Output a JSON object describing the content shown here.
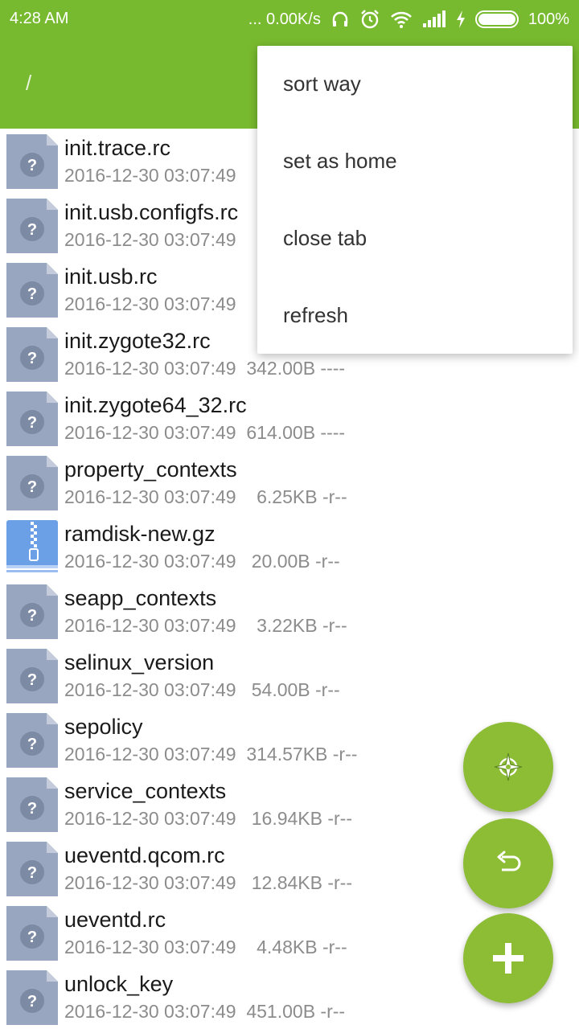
{
  "status_bar": {
    "time": "4:28 AM",
    "network_speed": "... 0.00K/s",
    "battery_percent": "100%",
    "icons": [
      "headset-icon",
      "alarm-icon",
      "wifi-icon",
      "signal-icon",
      "charging-icon",
      "battery-icon"
    ]
  },
  "app_bar": {
    "path": "/"
  },
  "menu": {
    "items": [
      {
        "label": "sort way"
      },
      {
        "label": "set as home"
      },
      {
        "label": "close tab"
      },
      {
        "label": "refresh"
      }
    ]
  },
  "files": [
    {
      "name": "init.trace.rc",
      "meta": "2016-12-30 03:07:49",
      "icon": "unknown-file-icon"
    },
    {
      "name": "init.usb.configfs.rc",
      "meta": "2016-12-30 03:07:49",
      "icon": "unknown-file-icon"
    },
    {
      "name": "init.usb.rc",
      "meta": "2016-12-30 03:07:49",
      "icon": "unknown-file-icon"
    },
    {
      "name": "init.zygote32.rc",
      "meta": "2016-12-30 03:07:49  342.00B ----",
      "icon": "unknown-file-icon"
    },
    {
      "name": "init.zygote64_32.rc",
      "meta": "2016-12-30 03:07:49  614.00B ----",
      "icon": "unknown-file-icon"
    },
    {
      "name": "property_contexts",
      "meta": "2016-12-30 03:07:49    6.25KB -r--",
      "icon": "unknown-file-icon"
    },
    {
      "name": "ramdisk-new.gz",
      "meta": "2016-12-30 03:07:49   20.00B -r--",
      "icon": "archive-file-icon"
    },
    {
      "name": "seapp_contexts",
      "meta": "2016-12-30 03:07:49    3.22KB -r--",
      "icon": "unknown-file-icon"
    },
    {
      "name": "selinux_version",
      "meta": "2016-12-30 03:07:49   54.00B -r--",
      "icon": "unknown-file-icon"
    },
    {
      "name": "sepolicy",
      "meta": "2016-12-30 03:07:49  314.57KB -r--",
      "icon": "unknown-file-icon"
    },
    {
      "name": "service_contexts",
      "meta": "2016-12-30 03:07:49   16.94KB -r--",
      "icon": "unknown-file-icon"
    },
    {
      "name": "ueventd.qcom.rc",
      "meta": "2016-12-30 03:07:49   12.84KB -r--",
      "icon": "unknown-file-icon"
    },
    {
      "name": "ueventd.rc",
      "meta": "2016-12-30 03:07:49    4.48KB -r--",
      "icon": "unknown-file-icon"
    },
    {
      "name": "unlock_key",
      "meta": "2016-12-30 03:07:49  451.00B -r--",
      "icon": "unknown-file-icon"
    }
  ],
  "fabs": {
    "locate": "locate-icon",
    "back": "undo-icon",
    "add": "plus-icon"
  },
  "colors": {
    "primary": "#78ba2f",
    "fab": "#8cbd35",
    "file_icon": "#98a6bf",
    "archive_icon": "#6b9fe6"
  }
}
